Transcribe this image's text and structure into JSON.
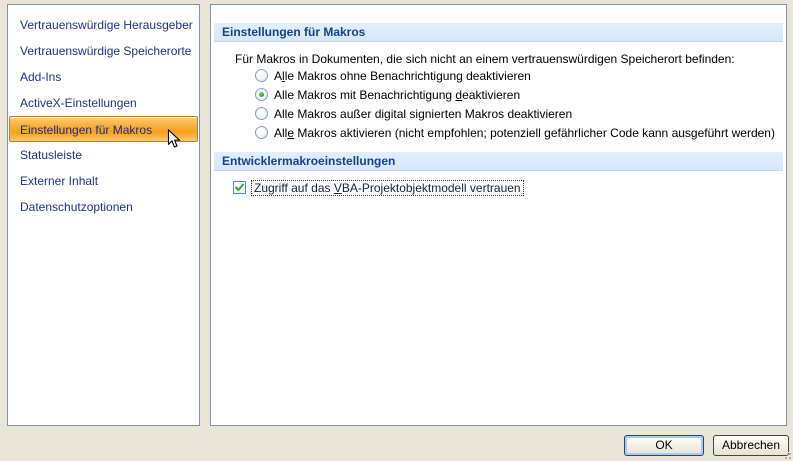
{
  "dialog": {
    "sidebar": {
      "items": [
        {
          "label": "Vertrauenswürdige Herausgeber",
          "selected": false
        },
        {
          "label": "Vertrauenswürdige Speicherorte",
          "selected": false
        },
        {
          "label": "Add-Ins",
          "selected": false
        },
        {
          "label": "ActiveX-Einstellungen",
          "selected": false
        },
        {
          "label": "Einstellungen für Makros",
          "selected": true
        },
        {
          "label": "Statusleiste",
          "selected": false
        },
        {
          "label": "Externer Inhalt",
          "selected": false
        },
        {
          "label": "Datenschutzoptionen",
          "selected": false
        }
      ]
    },
    "macro_section": {
      "header": "Einstellungen für Makros",
      "intro": "Für Makros in Dokumenten, die sich nicht an einem vertrauenswürdigen Speicherort befinden:",
      "options": [
        {
          "pre": "A",
          "key": "l",
          "post": "le Makros ohne Benachrichtigung deaktivieren",
          "selected": false
        },
        {
          "pre": "Alle Makros mit Benachrichtigung ",
          "key": "d",
          "post": "eaktivieren",
          "selected": true
        },
        {
          "pre": "Alle Makros außer di",
          "key": "g",
          "post": "ital signierten Makros deaktivieren",
          "selected": false
        },
        {
          "pre": "All",
          "key": "e",
          "post": " Makros aktivieren (nicht empfohlen; potenziell gefährlicher Code kann ausgeführt werden)",
          "selected": false
        }
      ]
    },
    "developer_section": {
      "header": "Entwicklermakroeinstellungen",
      "checkbox": {
        "pre": "Zugriff auf das ",
        "key": "V",
        "post": "BA-Projektobjektmodell vertrauen",
        "checked": true
      }
    },
    "footer": {
      "ok_label": "OK",
      "cancel_label": "Abbrechen"
    },
    "colors": {
      "background": "#e9e6d8",
      "panel_border": "#7f91ad",
      "sidebar_text": "#1f3388",
      "selection_orange": "#f7a428",
      "selection_border": "#bf8029",
      "header_band": "#dcebfa",
      "header_text": "#15428b",
      "radio_dot_green": "#41a33f",
      "check_green": "#37a437"
    }
  }
}
